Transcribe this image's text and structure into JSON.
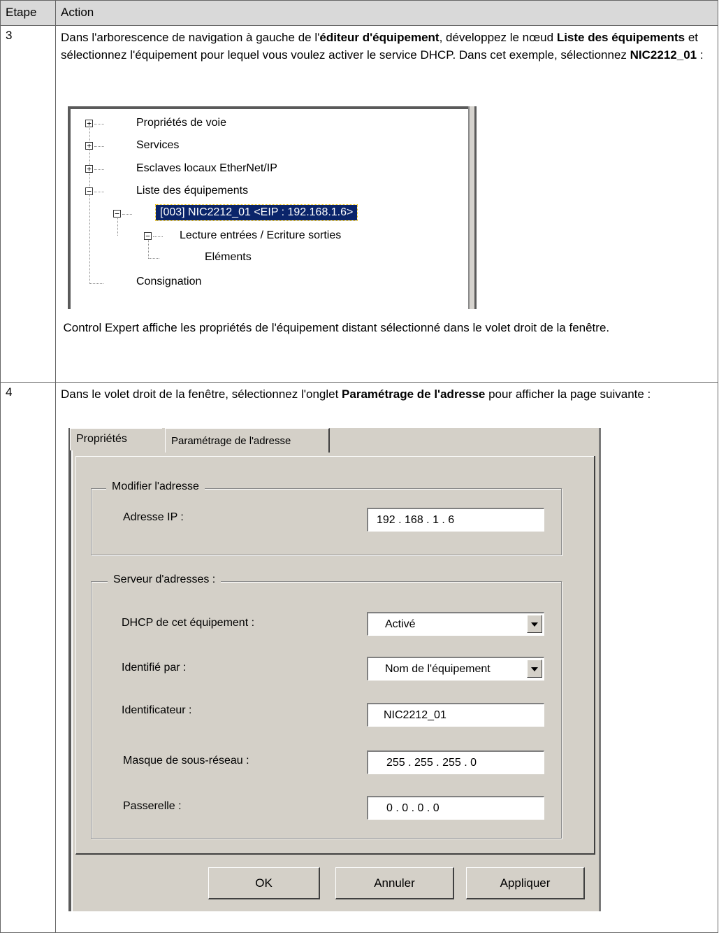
{
  "table": {
    "header_step": "Etape",
    "header_action": "Action"
  },
  "step3": {
    "number": "3",
    "text_1": "Dans l'arborescence de navigation à gauche de l'",
    "text_bold_1": "éditeur d'équipement",
    "text_2": ", développez le nœud ",
    "text_bold_2": "Liste des équipements",
    "text_3": " et sélectionnez l'équipement pour lequel vous voulez activer le service DHCP. Dans cet exemple, sélectionnez ",
    "text_bold_3": "NIC2212_01",
    "text_4": " :",
    "tree": {
      "items": [
        {
          "label": "Propriétés de voie",
          "toggle": "+"
        },
        {
          "label": "Services",
          "toggle": "+"
        },
        {
          "label": "Esclaves locaux EtherNet/IP",
          "toggle": "+"
        },
        {
          "label": "Liste des équipements",
          "toggle": "−"
        },
        {
          "label": "[003] NIC2212_01 <EIP : 192.168.1.6>",
          "toggle": "−"
        },
        {
          "label": "Lecture entrées / Ecriture sorties",
          "toggle": "−"
        },
        {
          "label": "Eléments"
        },
        {
          "label": "Consignation"
        }
      ]
    },
    "after_text": "Control Expert affiche les propriétés de l'équipement distant sélectionné dans le volet droit de la fenêtre."
  },
  "step4": {
    "number": "4",
    "text_1": "Dans le volet droit de la fenêtre, sélectionnez l'onglet ",
    "text_bold_1": "Paramétrage de l'adresse",
    "text_2": " pour afficher la page suivante :",
    "dialog": {
      "tabs": [
        "Propriétés",
        "Paramétrage de l'adresse"
      ],
      "group_modify": "Modifier l'adresse",
      "ip_label": "Adresse IP :",
      "ip_value": "192  .  168  .  1  .  6",
      "group_server": "Serveur d'adresses :",
      "dhcp_label": "DHCP de cet équipement :",
      "dhcp_value": "Activé",
      "identified_label": "Identifié par :",
      "identified_value": "Nom de l'équipement",
      "identifier_label": "Identificateur :",
      "identifier_value": "NIC2212_01",
      "mask_label": "Masque de sous-réseau :",
      "mask_value": "255  .  255  . 255 .  0",
      "gateway_label": "Passerelle :",
      "gateway_value": "0   .   0   .  0  .  0",
      "ok": "OK",
      "cancel": "Annuler",
      "apply": "Appliquer"
    }
  }
}
